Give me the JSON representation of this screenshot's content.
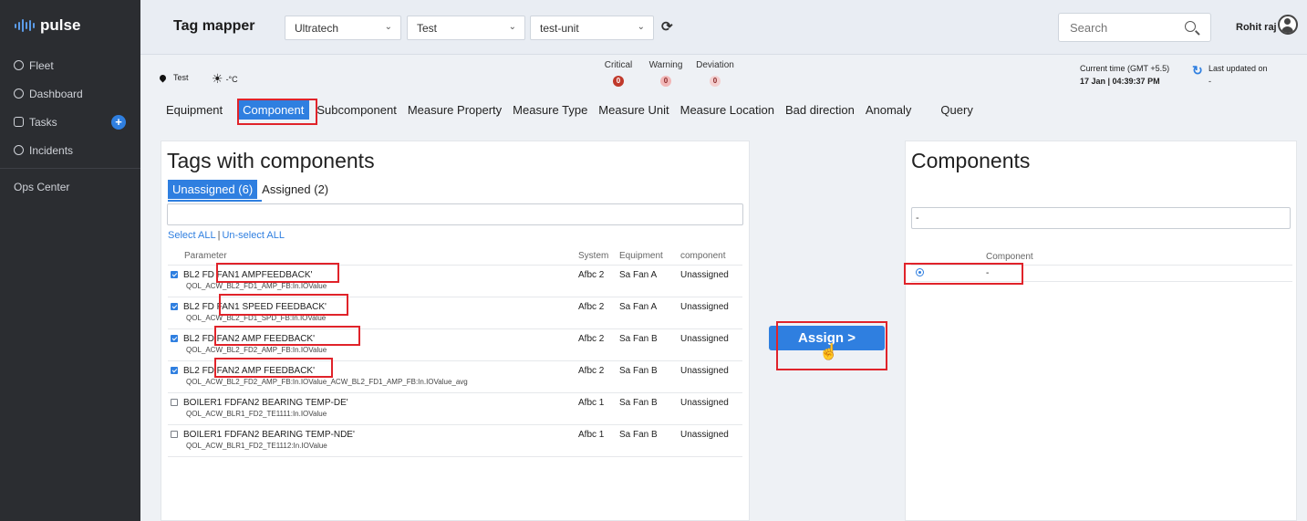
{
  "sidebar": {
    "logo": "pulse",
    "items": [
      {
        "label": "Fleet",
        "icon": "fleet-icon"
      },
      {
        "label": "Dashboard",
        "icon": "dashboard-icon"
      },
      {
        "label": "Tasks",
        "icon": "tasks-icon"
      },
      {
        "label": "Incidents",
        "icon": "info-icon"
      }
    ],
    "ops_center": "Ops Center"
  },
  "header": {
    "title": "Tag mapper",
    "selects": {
      "company": "Ultratech",
      "site": "Test",
      "unit": "test-unit"
    },
    "search_placeholder": "Search",
    "user": "Rohit raj"
  },
  "info": {
    "location": "Test",
    "weather": "-°C",
    "alerts": [
      {
        "label": "Critical",
        "count": "0",
        "color": "#c0392b"
      },
      {
        "label": "Warning",
        "count": "0",
        "color": "#f2b7b7"
      },
      {
        "label": "Deviation",
        "count": "0",
        "color": "#f4d0d0"
      }
    ],
    "current_time_label": "Current time (GMT +5.5)",
    "current_time": "17 Jan | 04:39:37 PM",
    "last_updated_label": "Last updated on",
    "last_updated": "-"
  },
  "tabs": [
    "Equipment",
    "Component",
    "Subcomponent",
    "Measure Property",
    "Measure Type",
    "Measure Unit",
    "Measure Location",
    "Bad direction",
    "Anomaly",
    "Query"
  ],
  "active_tab": "Component",
  "left_panel": {
    "title": "Tags with components",
    "subtabs": [
      "Unassigned (6)",
      "Assigned (2)"
    ],
    "filter_value": "",
    "select_all": "Select ALL",
    "unselect_all": "Un-select ALL",
    "columns": [
      "Parameter",
      "System",
      "Equipment",
      "component"
    ],
    "rows": [
      {
        "checked": true,
        "name": "BL2 FD FAN1 AMPFEEDBACK'",
        "tag": "QOL_ACW_BL2_FD1_AMP_FB:In.IOValue",
        "system": "Afbc 2",
        "equipment": "Sa Fan A",
        "component": "Unassigned"
      },
      {
        "checked": true,
        "name": "BL2 FD FAN1 SPEED FEEDBACK'",
        "tag": "QOL_ACW_BL2_FD1_SPD_FB:In.IOValue",
        "system": "Afbc 2",
        "equipment": "Sa Fan A",
        "component": "Unassigned"
      },
      {
        "checked": true,
        "name": "BL2 FD FAN2 AMP FEEDBACK'",
        "tag": "QOL_ACW_BL2_FD2_AMP_FB:In.IOValue",
        "system": "Afbc 2",
        "equipment": "Sa Fan B",
        "component": "Unassigned"
      },
      {
        "checked": true,
        "name": "BL2 FD FAN2 AMP FEEDBACK'",
        "tag": "QOL_ACW_BL2_FD2_AMP_FB:In.IOValue_ACW_BL2_FD1_AMP_FB:In.IOValue_avg",
        "system": "Afbc 2",
        "equipment": "Sa Fan B",
        "component": "Unassigned"
      },
      {
        "checked": false,
        "name": "BOILER1 FDFAN2 BEARING TEMP-DE'",
        "tag": "QOL_ACW_BLR1_FD2_TE1111:In.IOValue",
        "system": "Afbc 1",
        "equipment": "Sa Fan B",
        "component": "Unassigned"
      },
      {
        "checked": false,
        "name": "BOILER1 FDFAN2 BEARING TEMP-NDE'",
        "tag": "QOL_ACW_BLR1_FD2_TE1112:In.IOValue",
        "system": "Afbc 1",
        "equipment": "Sa Fan B",
        "component": "Unassigned"
      }
    ]
  },
  "assign_button": "Assign >",
  "right_panel": {
    "title": "Components",
    "filter_value": "-",
    "columns": [
      "",
      "Component"
    ],
    "rows": [
      {
        "selected": true,
        "component": "-"
      }
    ]
  },
  "colors": {
    "accent": "#2f7fe0",
    "sidebar": "#2b2d31",
    "highlight": "#e0232a"
  }
}
